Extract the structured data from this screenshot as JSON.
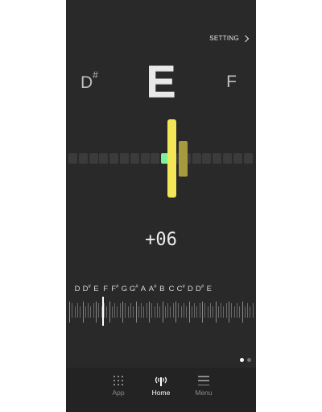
{
  "header": {
    "setting_label": "SETTING"
  },
  "tuner": {
    "current_note": "E",
    "prev_note": "D",
    "prev_accidental": "#",
    "next_note": "F",
    "cents": "+06",
    "in_tune_color": "#7cf09a",
    "needle_color": "#f3e657"
  },
  "scale": {
    "notes": [
      {
        "name": "D",
        "acc": ""
      },
      {
        "name": "D",
        "acc": "#"
      },
      {
        "name": "E",
        "acc": ""
      },
      {
        "name": "F",
        "acc": ""
      },
      {
        "name": "F",
        "acc": "#"
      },
      {
        "name": "G",
        "acc": ""
      },
      {
        "name": "G",
        "acc": "#"
      },
      {
        "name": "A",
        "acc": ""
      },
      {
        "name": "A",
        "acc": "#"
      },
      {
        "name": "B",
        "acc": ""
      },
      {
        "name": "C",
        "acc": ""
      },
      {
        "name": "C",
        "acc": "#"
      },
      {
        "name": "D",
        "acc": ""
      },
      {
        "name": "D",
        "acc": "#"
      },
      {
        "name": "E",
        "acc": ""
      }
    ],
    "selected_note": "E"
  },
  "pager": {
    "pages": 2,
    "active": 0
  },
  "navbar": {
    "items": [
      {
        "label": "App",
        "icon": "grid-icon",
        "active": false
      },
      {
        "label": "Home",
        "icon": "tuning-fork-signal-icon",
        "active": true
      },
      {
        "label": "Menu",
        "icon": "menu-icon",
        "active": false
      }
    ]
  }
}
